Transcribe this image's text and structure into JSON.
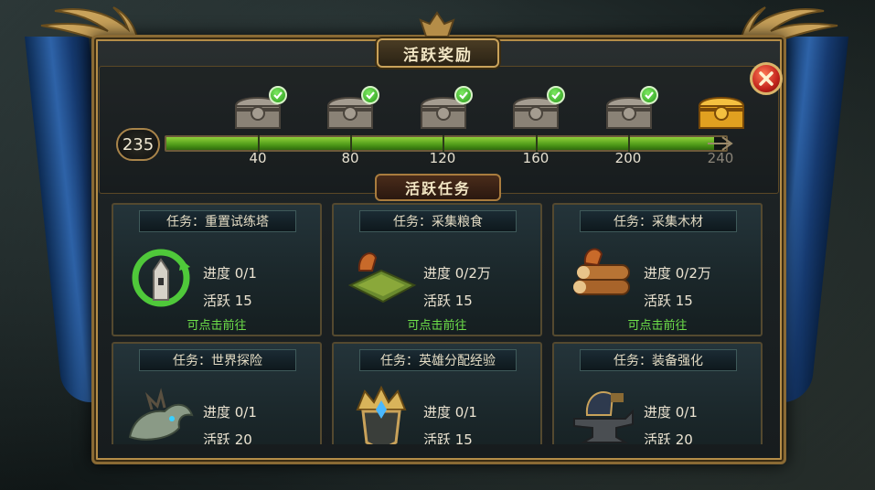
{
  "header": {
    "title": "活跃奖励"
  },
  "progress": {
    "current": "235",
    "max_value": 240,
    "fill_fraction": 0.979,
    "milestones": [
      {
        "label": "40",
        "claimed": true
      },
      {
        "label": "80",
        "claimed": true
      },
      {
        "label": "120",
        "claimed": true
      },
      {
        "label": "160",
        "claimed": true
      },
      {
        "label": "200",
        "claimed": true
      },
      {
        "label": "240",
        "claimed": false
      }
    ]
  },
  "section": {
    "title": "活跃任务"
  },
  "tasks": [
    {
      "title": "任务：重置试练塔",
      "progress": "进度 0/1",
      "activity": "活跃 15",
      "action": "可点击前往",
      "icon": "tower-icon"
    },
    {
      "title": "任务：采集粮食",
      "progress": "进度 0/2万",
      "activity": "活跃 15",
      "action": "可点击前往",
      "icon": "farm-icon"
    },
    {
      "title": "任务：采集木材",
      "progress": "进度 0/2万",
      "activity": "活跃 15",
      "action": "可点击前往",
      "icon": "wood-icon"
    },
    {
      "title": "任务：世界探险",
      "progress": "进度 0/1",
      "activity": "活跃 20",
      "action": "",
      "icon": "dragon-icon"
    },
    {
      "title": "任务：英雄分配经验",
      "progress": "进度 0/1",
      "activity": "活跃 15",
      "action": "",
      "icon": "helmet-icon"
    },
    {
      "title": "任务：装备强化",
      "progress": "进度 0/1",
      "activity": "活跃 20",
      "action": "",
      "icon": "anvil-icon"
    }
  ],
  "colors": {
    "accent_gold": "#c9a25a",
    "bar_green": "#6ab82a",
    "go_green": "#6ee04a",
    "close_red": "#c2241c"
  }
}
